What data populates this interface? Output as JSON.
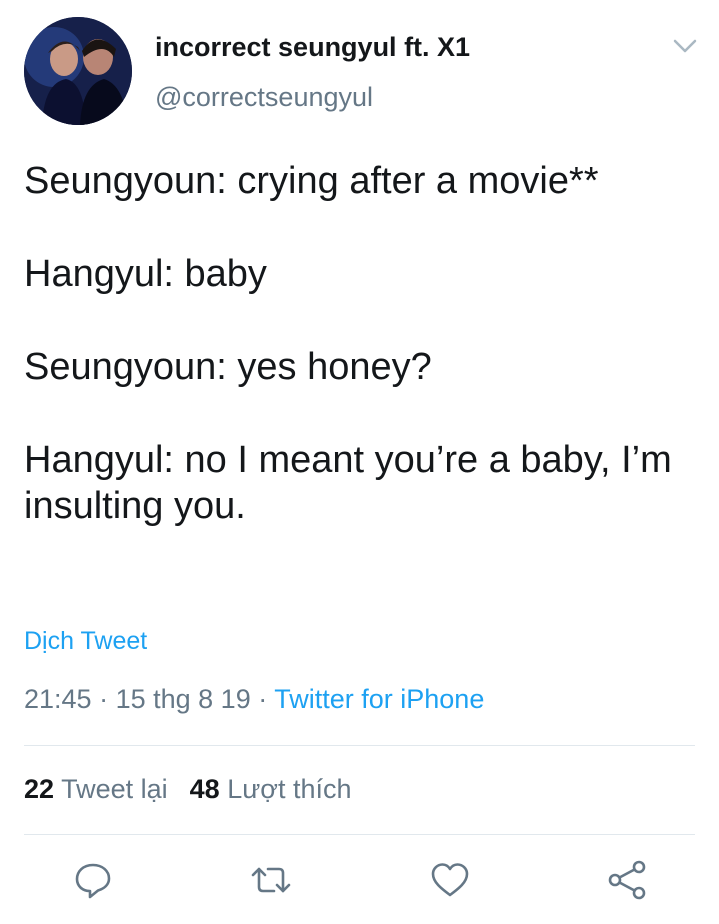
{
  "author": {
    "display_name": "incorrect seungyul ft. X1",
    "handle": "@correctseungyul"
  },
  "tweet": {
    "lines": [
      "Seungyoun: crying after a movie**",
      "Hangyul: baby",
      "Seungyoun: yes honey?",
      "Hangyul: no I meant you’re a baby, I’m insulting you."
    ],
    "translate_label": "Dịch Tweet",
    "time": "21:45",
    "date": "15 thg 8 19",
    "source": "Twitter for iPhone"
  },
  "stats": {
    "retweets_count": "22",
    "retweets_label": "Tweet lại",
    "likes_count": "48",
    "likes_label": "Lượt thích"
  },
  "colors": {
    "text": "#14171a",
    "secondary": "#657786",
    "link": "#1da1f2",
    "divider": "#e1e8ed"
  },
  "icons": {
    "caret": "chevron-down-icon",
    "reply": "reply-icon",
    "retweet": "retweet-icon",
    "like": "heart-icon",
    "share": "share-icon"
  }
}
